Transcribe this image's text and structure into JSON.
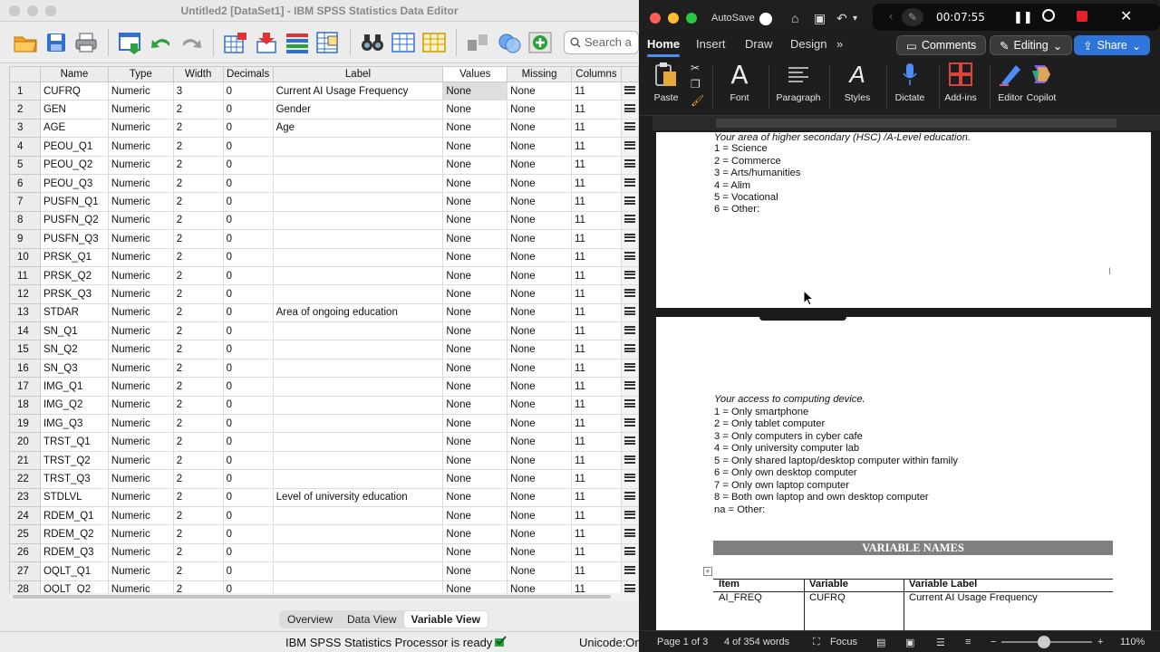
{
  "spss": {
    "window_title": "Untitled2 [DataSet1] - IBM SPSS Statistics Data Editor",
    "search_placeholder": "Search a",
    "columns": [
      "Name",
      "Type",
      "Width",
      "Decimals",
      "Label",
      "Values",
      "Missing",
      "Columns"
    ],
    "rows": [
      [
        "1",
        "CUFRQ",
        "Numeric",
        "3",
        "0",
        "Current AI Usage Frequency",
        "None",
        "None",
        "11"
      ],
      [
        "2",
        "GEN",
        "Numeric",
        "2",
        "0",
        "Gender",
        "None",
        "None",
        "11"
      ],
      [
        "3",
        "AGE",
        "Numeric",
        "2",
        "0",
        "Age",
        "None",
        "None",
        "11"
      ],
      [
        "4",
        "PEOU_Q1",
        "Numeric",
        "2",
        "0",
        "",
        "None",
        "None",
        "11"
      ],
      [
        "5",
        "PEOU_Q2",
        "Numeric",
        "2",
        "0",
        "",
        "None",
        "None",
        "11"
      ],
      [
        "6",
        "PEOU_Q3",
        "Numeric",
        "2",
        "0",
        "",
        "None",
        "None",
        "11"
      ],
      [
        "7",
        "PUSFN_Q1",
        "Numeric",
        "2",
        "0",
        "",
        "None",
        "None",
        "11"
      ],
      [
        "8",
        "PUSFN_Q2",
        "Numeric",
        "2",
        "0",
        "",
        "None",
        "None",
        "11"
      ],
      [
        "9",
        "PUSFN_Q3",
        "Numeric",
        "2",
        "0",
        "",
        "None",
        "None",
        "11"
      ],
      [
        "10",
        "PRSK_Q1",
        "Numeric",
        "2",
        "0",
        "",
        "None",
        "None",
        "11"
      ],
      [
        "11",
        "PRSK_Q2",
        "Numeric",
        "2",
        "0",
        "",
        "None",
        "None",
        "11"
      ],
      [
        "12",
        "PRSK_Q3",
        "Numeric",
        "2",
        "0",
        "",
        "None",
        "None",
        "11"
      ],
      [
        "13",
        "STDAR",
        "Numeric",
        "2",
        "0",
        "Area of ongoing education",
        "None",
        "None",
        "11"
      ],
      [
        "14",
        "SN_Q1",
        "Numeric",
        "2",
        "0",
        "",
        "None",
        "None",
        "11"
      ],
      [
        "15",
        "SN_Q2",
        "Numeric",
        "2",
        "0",
        "",
        "None",
        "None",
        "11"
      ],
      [
        "16",
        "SN_Q3",
        "Numeric",
        "2",
        "0",
        "",
        "None",
        "None",
        "11"
      ],
      [
        "17",
        "IMG_Q1",
        "Numeric",
        "2",
        "0",
        "",
        "None",
        "None",
        "11"
      ],
      [
        "18",
        "IMG_Q2",
        "Numeric",
        "2",
        "0",
        "",
        "None",
        "None",
        "11"
      ],
      [
        "19",
        "IMG_Q3",
        "Numeric",
        "2",
        "0",
        "",
        "None",
        "None",
        "11"
      ],
      [
        "20",
        "TRST_Q1",
        "Numeric",
        "2",
        "0",
        "",
        "None",
        "None",
        "11"
      ],
      [
        "21",
        "TRST_Q2",
        "Numeric",
        "2",
        "0",
        "",
        "None",
        "None",
        "11"
      ],
      [
        "22",
        "TRST_Q3",
        "Numeric",
        "2",
        "0",
        "",
        "None",
        "None",
        "11"
      ],
      [
        "23",
        "STDLVL",
        "Numeric",
        "2",
        "0",
        "Level of university education",
        "None",
        "None",
        "11"
      ],
      [
        "24",
        "RDEM_Q1",
        "Numeric",
        "2",
        "0",
        "",
        "None",
        "None",
        "11"
      ],
      [
        "25",
        "RDEM_Q2",
        "Numeric",
        "2",
        "0",
        "",
        "None",
        "None",
        "11"
      ],
      [
        "26",
        "RDEM_Q3",
        "Numeric",
        "2",
        "0",
        "",
        "None",
        "None",
        "11"
      ],
      [
        "27",
        "OQLT_Q1",
        "Numeric",
        "2",
        "0",
        "",
        "None",
        "None",
        "11"
      ],
      [
        "28",
        "OQLT_Q2",
        "Numeric",
        "2",
        "0",
        "",
        "None",
        "None",
        "11"
      ]
    ],
    "view_tabs": [
      "Overview",
      "Data View",
      "Variable View"
    ],
    "active_view": "Variable View",
    "status": "IBM SPSS Statistics Processor is ready",
    "encoding": "Unicode:On"
  },
  "word": {
    "autosave_label": "AutoSave",
    "recording_time": "00:07:55",
    "tabs": [
      "Home",
      "Insert",
      "Draw",
      "Design"
    ],
    "comments_label": "Comments",
    "editing_label": "Editing",
    "share_label": "Share",
    "ribbon_groups": [
      "Paste",
      "Font",
      "Paragraph",
      "Styles",
      "Dictate",
      "Add-ins",
      "Editor",
      "Copilot"
    ],
    "doc": {
      "hsc_heading": "Your area of higher secondary (HSC) /A-Level education.",
      "hsc_options": [
        "1 = Science",
        "2 = Commerce",
        "3 = Arts/humanities",
        "4 = Alim",
        "5 = Vocational",
        "6 = Other:"
      ],
      "device_heading": "Your access to computing device.",
      "device_options": [
        "1 = Only smartphone",
        "2 = Only tablet computer",
        "3 = Only computers in cyber cafe",
        "4 = Only university computer lab",
        "5 = Only shared laptop/desktop computer within family",
        "6 = Only own desktop computer",
        "7 = Only own laptop computer",
        "8 = Both own laptop and own desktop computer",
        "na = Other:"
      ],
      "section_title": "VARIABLE NAMES",
      "table_headers": [
        "Item",
        "Variable",
        "Variable Label"
      ],
      "table_row": [
        "AI_FREQ",
        "CUFRQ",
        "Current AI Usage Frequency"
      ]
    },
    "status": {
      "page": "Page 1 of 3",
      "words": "4 of 354 words",
      "focus": "Focus",
      "zoom": "110%"
    }
  }
}
